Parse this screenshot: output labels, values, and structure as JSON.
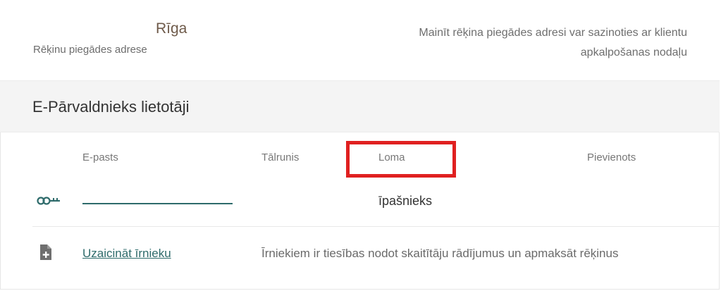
{
  "address": {
    "city": "Rīga",
    "label": "Rēķinu piegādes adrese",
    "note": "Mainīt rēķina piegādes adresi var sazinoties ar klientu apkalpošanas nodaļu"
  },
  "users": {
    "title": "E-Pārvaldnieks lietotāji",
    "columns": [
      "E-pasts",
      "Tālrunis",
      "Loma",
      "Pievienots"
    ],
    "rows": [
      {
        "role": "īpašnieks",
        "icon": "key-icon"
      }
    ],
    "invite": {
      "icon": "add-document-icon",
      "link_label": "Uzaicināt īrnieku",
      "description": "Īrniekiem ir tiesības nodot skaitītāju rādījumus un apmaksāt rēķinus"
    }
  },
  "colors": {
    "accent": "#2e6b6b",
    "highlight": "#e02020",
    "header_bg": "#f4f4f4"
  }
}
